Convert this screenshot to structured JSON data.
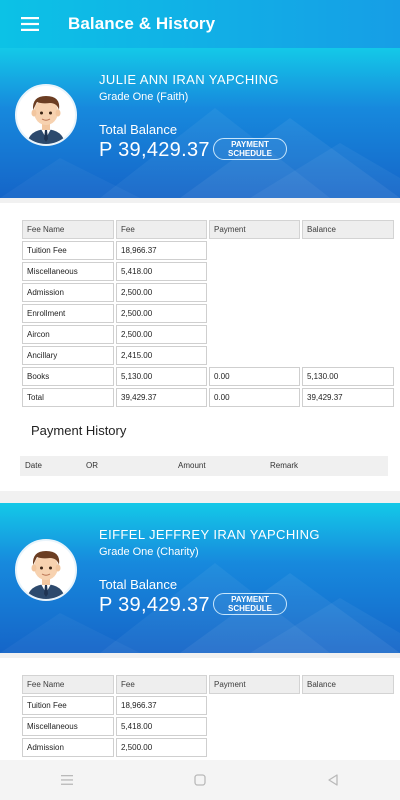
{
  "app": {
    "title": "Balance & History"
  },
  "students": [
    {
      "name": "JULIE ANN IRAN YAPCHING",
      "grade": "Grade One (Faith)",
      "total_label": "Total Balance",
      "total_value": "P 39,429.37",
      "payment_schedule_label_1": "PAYMENT",
      "payment_schedule_label_2": "SCHEDULE",
      "fee_headers": [
        "Fee Name",
        "Fee",
        "Payment",
        "Balance"
      ],
      "fees": [
        {
          "name": "Tuition Fee",
          "fee": "18,966.37",
          "payment": "",
          "balance": ""
        },
        {
          "name": "Miscellaneous",
          "fee": "5,418.00",
          "payment": "",
          "balance": ""
        },
        {
          "name": "Admission",
          "fee": "2,500.00",
          "payment": "",
          "balance": ""
        },
        {
          "name": "Enrollment",
          "fee": "2,500.00",
          "payment": "",
          "balance": ""
        },
        {
          "name": "Aircon",
          "fee": "2,500.00",
          "payment": "",
          "balance": ""
        },
        {
          "name": "Ancillary",
          "fee": "2,415.00",
          "payment": "",
          "balance": ""
        },
        {
          "name": "Books",
          "fee": "5,130.00",
          "payment": "0.00",
          "balance": "5,130.00"
        },
        {
          "name": "Total",
          "fee": "39,429.37",
          "payment": "0.00",
          "balance": "39,429.37"
        }
      ],
      "history_title": "Payment History",
      "history_headers": [
        "Date",
        "OR",
        "Amount",
        "Remark"
      ]
    },
    {
      "name": "EIFFEL JEFFREY IRAN YAPCHING",
      "grade": "Grade One (Charity)",
      "total_label": "Total Balance",
      "total_value": "P 39,429.37",
      "payment_schedule_label_1": "PAYMENT",
      "payment_schedule_label_2": "SCHEDULE",
      "fee_headers": [
        "Fee Name",
        "Fee",
        "Payment",
        "Balance"
      ],
      "fees": [
        {
          "name": "Tuition Fee",
          "fee": "18,966.37"
        },
        {
          "name": "Miscellaneous",
          "fee": "5,418.00"
        },
        {
          "name": "Admission",
          "fee": "2,500.00"
        }
      ]
    }
  ],
  "icons": {
    "menu": "menu-icon",
    "avatar": "student-avatar",
    "nav": [
      "recent-apps-icon",
      "home-icon",
      "back-icon"
    ]
  },
  "colors": {
    "appbar_start": "#0cc2e6",
    "appbar_end": "#169ee6",
    "header_text": "#ffffff"
  }
}
